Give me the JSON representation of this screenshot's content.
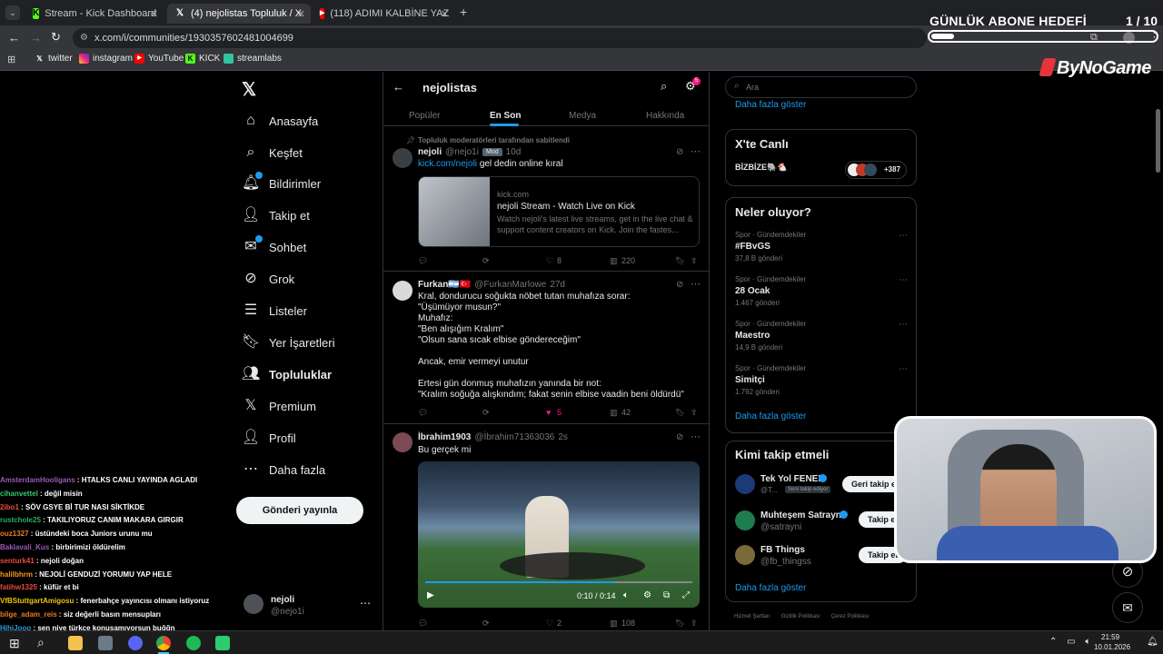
{
  "browser": {
    "tabs": [
      {
        "title": "Stream - Kick Dashboard",
        "favicon": "kick-icon"
      },
      {
        "title": "(4) nejolistas Topluluk / X",
        "favicon": "x-icon"
      },
      {
        "title": "(118) ADIMI KALBİNE YAZ",
        "favicon": "youtube-icon"
      }
    ],
    "url": "x.com/i/communities/1930357602481004699",
    "bookmarks": [
      "twitter",
      "instagram",
      "YouTube",
      "KICK",
      "streamlabs"
    ]
  },
  "overlay": {
    "goal_title": "GÜNLÜK ABONE HEDEFİ",
    "goal_count": "1 / 10",
    "goal_progress": 0.1,
    "brand": "ByNoGame"
  },
  "nav": {
    "items": [
      "Anasayfa",
      "Keşfet",
      "Bildirimler",
      "Takip et",
      "Sohbet",
      "Grok",
      "Listeler",
      "Yer İşaretleri",
      "Topluluklar",
      "Premium",
      "Profil",
      "Daha fazla"
    ],
    "post_button": "Gönderi yayınla",
    "account_name": "nejoli",
    "account_handle": "@nejo1i"
  },
  "community": {
    "title": "nejolistas",
    "notif_count": "5",
    "tabs": [
      "Popüler",
      "En Son",
      "Medya",
      "Hakkında"
    ]
  },
  "tweets": [
    {
      "pinned": "Topluluk moderatörleri tarafından sabitlendi",
      "name": "nejoli",
      "handle": "@nejo1i",
      "badge": "Mod",
      "time": "10d",
      "link": "kick.com/nejoli",
      "text": "gel dedin online kıral",
      "card": {
        "domain": "kick.com",
        "title": "nejoli Stream - Watch Live on Kick",
        "desc": "Watch nejoli's latest live streams, get in the live chat & support content creators on Kick. Join the fastes..."
      },
      "likes": "8",
      "views": "220"
    },
    {
      "name": "Furkan🇦🇷🇹🇷",
      "handle": "@FurkanMarlowe",
      "time": "27d",
      "lines": [
        "Kral, dondurucu soğukta nöbet tutan muhafıza sorar:",
        "\"Üşümüyor musun?\"",
        "Muhafız:",
        "\"Ben alışığım Kralım\"",
        "\"Olsun sana sıcak elbise göndereceğim\"",
        "",
        "Ancak, emir vermeyi unutur",
        "",
        "Ertesi gün donmuş muhafızın yanında bir not:",
        "\"Kralım soğuğa alışkındım; fakat senin elbise vaadin beni öldürdü\""
      ],
      "likes": "5",
      "views": "42"
    },
    {
      "name": "İbrahim1903",
      "handle": "@İbrahim71363036",
      "time": "2s",
      "text": "Bu gerçek mi",
      "video_time": "0:10 / 0:14",
      "likes": "2",
      "views": "108"
    }
  ],
  "sidebar": {
    "search_placeholder": "Ara",
    "show_more": "Daha fazla göster",
    "live_title": "X'te Canlı",
    "live_space": "BİZBİZE🐘🐔",
    "live_count": "+387",
    "trends_title": "Neler oluyor?",
    "trends": [
      {
        "category": "Spor · Gündemdekiler",
        "name": "#FBvGS",
        "posts": "37,8 B gönderi"
      },
      {
        "category": "Spor · Gündemdekiler",
        "name": "28 Ocak",
        "posts": "1.467 gönderi"
      },
      {
        "category": "Spor · Gündemdekiler",
        "name": "Maestro",
        "posts": "14,9 B gönderi"
      },
      {
        "category": "Spor · Gündemdekiler",
        "name": "Simitçi",
        "posts": "1.792 gönderi"
      }
    ],
    "follow_title": "Kimi takip etmeli",
    "follows": [
      {
        "name": "Tek Yol FENER",
        "handle": "@T...",
        "note": "Seni takip ediyor",
        "button": "Geri takip e"
      },
      {
        "name": "Muhteşem Satrayni",
        "handle": "@satrayni",
        "button": "Takip e"
      },
      {
        "name": "FB Things",
        "handle": "@fb_thingss",
        "button": "Takip et"
      }
    ],
    "footer": [
      "Hizmet Şartları",
      "Gizlilik Politikası",
      "Çerez Politikası"
    ]
  },
  "chat": [
    {
      "user": "AmsterdamHooligans",
      "msg": "HTALKS CANLI YAYINDA AGLADI",
      "color": "#9b59b6"
    },
    {
      "user": "cihanvettel",
      "msg": "değil misin",
      "color": "#2ecc71"
    },
    {
      "user": "2ibo1",
      "msg": "SÖV GSYE Bİ TUR NASI SİKTİKDE",
      "color": "#e74c3c"
    },
    {
      "user": "rustchole25",
      "msg": "TAKILIYORUZ CANIM MAKARA GIRGIR",
      "color": "#27ae60"
    },
    {
      "user": "ouz1327",
      "msg": "üstündeki boca Juniors urunu mu",
      "color": "#e67e22"
    },
    {
      "user": "Baklavali_Kus",
      "msg": "birbirimizi öldürelim",
      "color": "#9b59b6"
    },
    {
      "user": "senturk41",
      "msg": "nejoli doğan",
      "color": "#e74c3c"
    },
    {
      "user": "halilbhrm",
      "msg": "NEJOLİ GENDUZİ YORUMU YAP HELE",
      "color": "#f39c12"
    },
    {
      "user": "fatihw1325",
      "msg": "küfür et bi",
      "color": "#e74c3c"
    },
    {
      "user": "VfBStuttgartAmigosu",
      "msg": "fenerbahçe yayıncısı olmanı istiyoruz",
      "color": "#f1c40f"
    },
    {
      "user": "bilge_adam_reis",
      "msg": "siz değerli basın mensupları",
      "color": "#e67e22"
    },
    {
      "user": "HihiJooo",
      "msg": "sen niye türkçe konuşamıyorsun buğğn",
      "color": "#3498db"
    }
  ],
  "taskbar": {
    "time": "21:59",
    "date": "10.01.2026"
  }
}
